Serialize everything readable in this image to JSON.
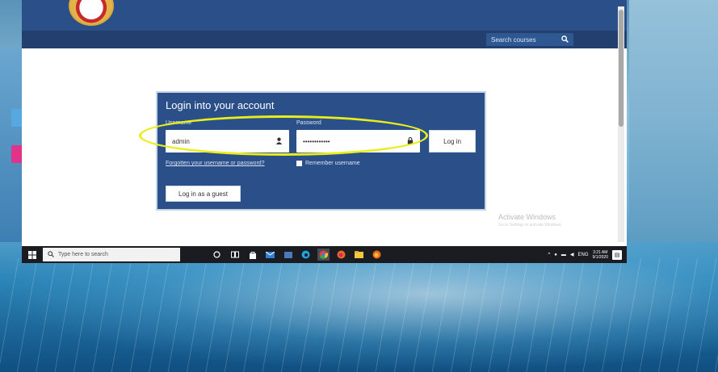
{
  "header": {
    "search_label": "Search courses",
    "search_icon": "magnifier"
  },
  "login": {
    "title": "Login into your account",
    "username_label": "Username",
    "username_value": "admin",
    "password_label": "Password",
    "password_value": "••••••••••••",
    "login_button": "Log in",
    "forgot_link": "Forgotten your username or password?",
    "remember_label": "Remember username",
    "guest_button": "Log in as a guest"
  },
  "watermark": {
    "line1": "Activate Windows",
    "line2": "Go to Settings to activate Windows."
  },
  "taskbar": {
    "search_placeholder": "Type here to search",
    "time": "3:21 AM",
    "date": "9/1/2020",
    "lang": "ENG"
  },
  "colors": {
    "brand_blue": "#2b4f88",
    "navbar": "#233f6e",
    "highlight": "#e8ee1a"
  }
}
